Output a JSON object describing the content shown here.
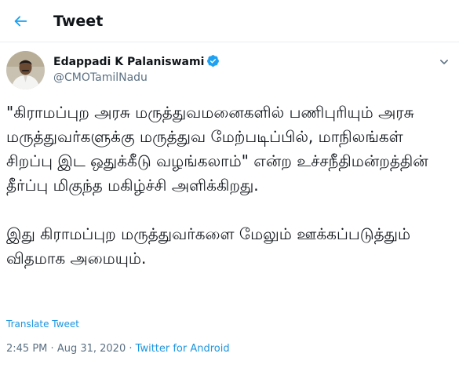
{
  "header": {
    "title": "Tweet",
    "back_icon": "arrow-left-icon",
    "accent_color": "#1da1f2"
  },
  "tweet": {
    "author_name": "Edappadi K Palaniswami",
    "author_handle": "@CMOTamilNadu",
    "verified_icon": "verified-badge-icon",
    "more_icon": "chevron-down-icon",
    "avatar_icon": "profile-photo",
    "text": "\"கிராமப்புற அரசு மருத்துவமனைகளில் பணிபுரியும் அரசு மருத்துவர்களுக்கு மருத்துவ மேற்படிப்பில், மாநிலங்கள் சிறப்பு இட ஒதுக்கீடு வழங்கலாம்\" என்ற உச்சநீதிமன்றத்தின் தீர்ப்பு மிகுந்த மகிழ்ச்சி அளிக்கிறது.\n\nஇது கிராமப்புற மருத்துவர்களை மேலும் ஊக்கப்படுத்தும் விதமாக அமையும்.",
    "translate_label": "Translate Tweet",
    "time": "2:45 PM",
    "separator": "·",
    "date": "Aug 31, 2020",
    "source": "Twitter for Android"
  }
}
